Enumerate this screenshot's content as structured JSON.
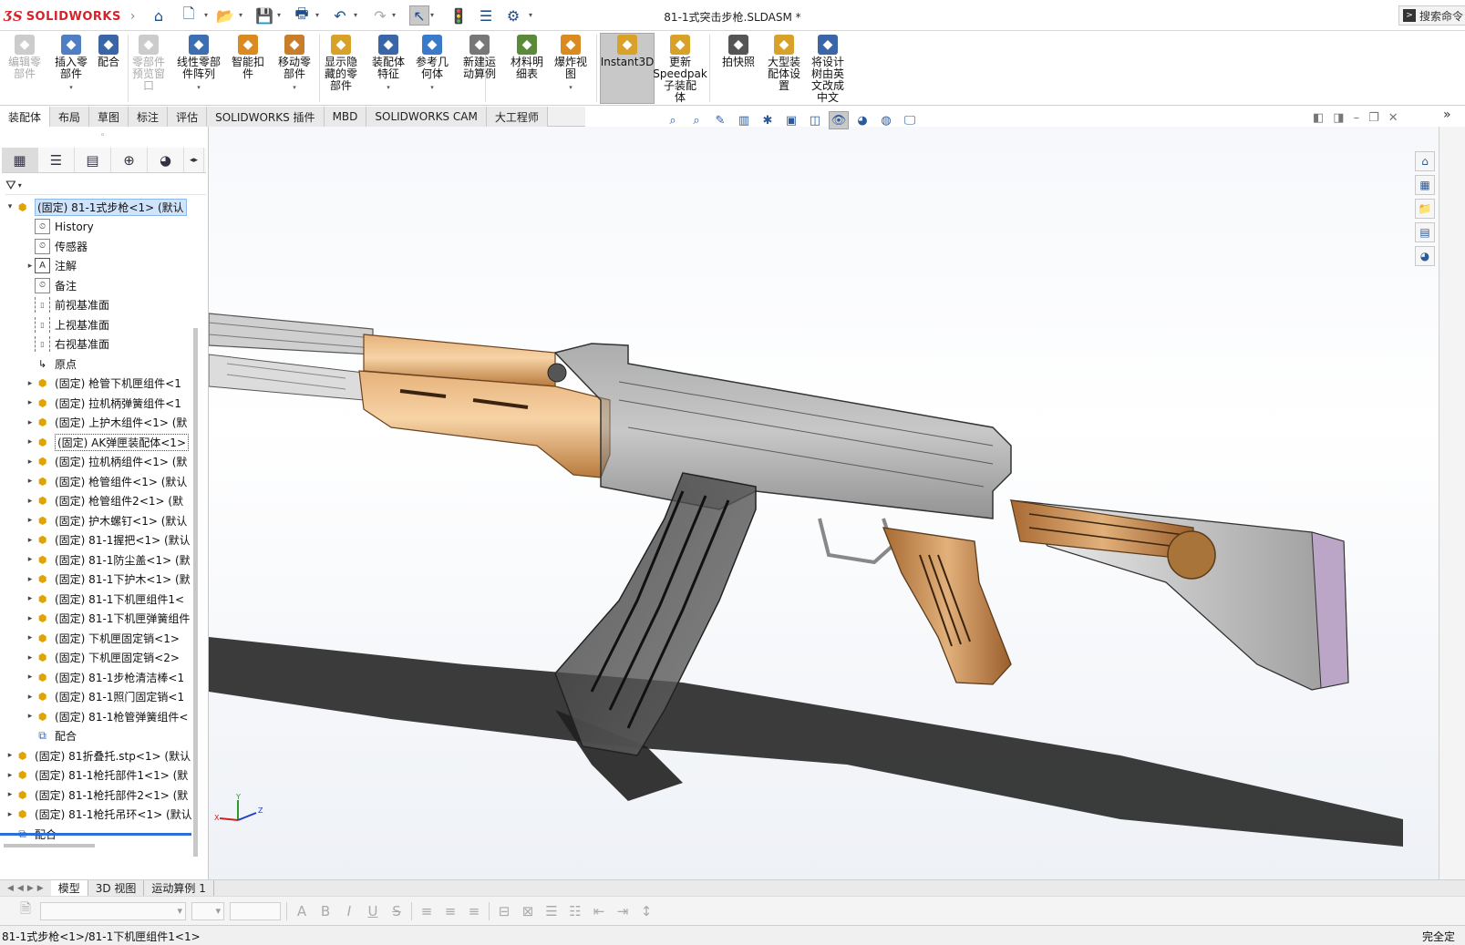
{
  "app": {
    "brand_ds": "ƷS",
    "brand_name": "SOLIDWORKS",
    "document_title": "81-1式突击步枪.SLDASM *",
    "search_placeholder": "搜索命令"
  },
  "quick_access": [
    {
      "name": "home-icon",
      "glyph": "⌂"
    },
    {
      "name": "new-document-icon",
      "glyph": "🗋"
    },
    {
      "name": "open-folder-icon",
      "glyph": "📂"
    },
    {
      "name": "save-icon",
      "glyph": "💾"
    },
    {
      "name": "print-icon",
      "glyph": "🖶"
    },
    {
      "name": "undo-icon",
      "glyph": "↶"
    },
    {
      "name": "redo-icon",
      "glyph": "↷"
    },
    {
      "name": "select-pointer-icon",
      "glyph": "↖"
    },
    {
      "name": "traffic-light-icon",
      "glyph": "🚦"
    },
    {
      "name": "file-properties-icon",
      "glyph": "☰"
    },
    {
      "name": "options-gear-icon",
      "glyph": "⚙"
    }
  ],
  "ribbon": {
    "buttons": [
      {
        "label": "编辑零\n部件",
        "disabled": true,
        "color": "#999"
      },
      {
        "label": "插入零\n部件",
        "disabled": false,
        "color": "#4f7fc2",
        "dropdown": true
      },
      {
        "label": "配合",
        "disabled": false,
        "color": "#3a66a8"
      },
      {
        "label": "零部件\n预览窗\n口",
        "disabled": true,
        "color": "#999"
      },
      {
        "label": "线性零部\n件阵列",
        "disabled": false,
        "color": "#3d6fb0",
        "dropdown": true
      },
      {
        "label": "智能扣\n件",
        "disabled": false,
        "color": "#d98b22"
      },
      {
        "label": "移动零\n部件",
        "disabled": false,
        "color": "#c87d2a",
        "dropdown": true
      },
      {
        "label": "显示隐\n藏的零\n部件",
        "disabled": false,
        "color": "#d8a22a"
      },
      {
        "label": "装配体\n特征",
        "disabled": false,
        "color": "#3a66a8",
        "dropdown": true
      },
      {
        "label": "参考几\n何体",
        "disabled": false,
        "color": "#3a7ac8",
        "dropdown": true
      },
      {
        "label": "新建运\n动算例",
        "disabled": false,
        "color": "#777"
      },
      {
        "label": "材料明\n细表",
        "disabled": false,
        "color": "#5a8a3a"
      },
      {
        "label": "爆炸视\n图",
        "disabled": false,
        "color": "#d98b22",
        "dropdown": true
      },
      {
        "label": "Instant3D",
        "disabled": false,
        "color": "#d8a22a",
        "active": true
      },
      {
        "label": "更新\nSpeedpak\n子装配\n体",
        "disabled": false,
        "color": "#d8a22a"
      },
      {
        "label": "拍快照",
        "disabled": false,
        "color": "#555"
      },
      {
        "label": "大型装\n配体设\n置",
        "disabled": false,
        "color": "#d8a22a"
      },
      {
        "label": "将设计\n树由英\n文改成\n中文",
        "disabled": false,
        "color": "#3a66a8"
      }
    ]
  },
  "tabs": [
    "装配体",
    "布局",
    "草图",
    "标注",
    "评估",
    "SOLIDWORKS 插件",
    "MBD",
    "SOLIDWORKS CAM",
    "大工程师"
  ],
  "left_toolbar": [
    "feature-manager-icon",
    "property-manager-icon",
    "configuration-manager-icon",
    "dimxpert-icon",
    "display-manager-icon"
  ],
  "tree": {
    "rows": [
      {
        "level": 0,
        "expand": "▾",
        "type": "asm",
        "label": "(固定) 81-1式步枪<1> (默认",
        "selected": true
      },
      {
        "level": 1,
        "expand": "",
        "type": "hist",
        "label": "History"
      },
      {
        "level": 1,
        "expand": "",
        "type": "hist",
        "label": "传感器"
      },
      {
        "level": 1,
        "expand": "▸",
        "type": "note",
        "label": "注解"
      },
      {
        "level": 1,
        "expand": "",
        "type": "hist",
        "label": "备注"
      },
      {
        "level": 1,
        "expand": "",
        "type": "plane",
        "label": "前视基准面"
      },
      {
        "level": 1,
        "expand": "",
        "type": "plane",
        "label": "上视基准面"
      },
      {
        "level": 1,
        "expand": "",
        "type": "plane",
        "label": "右视基准面"
      },
      {
        "level": 1,
        "expand": "",
        "type": "origin",
        "label": "原点"
      },
      {
        "level": 1,
        "expand": "▸",
        "type": "asm",
        "label": "(固定) 枪管下机匣组件<1"
      },
      {
        "level": 1,
        "expand": "▸",
        "type": "asm",
        "label": "(固定) 拉机柄弹簧组件<1"
      },
      {
        "level": 1,
        "expand": "▸",
        "type": "asm",
        "label": "(固定) 上护木组件<1> (默"
      },
      {
        "level": 1,
        "expand": "▸",
        "type": "asm",
        "label": "(固定) AK弹匣装配体<1>",
        "boxed": true
      },
      {
        "level": 1,
        "expand": "▸",
        "type": "asm",
        "label": "(固定) 拉机柄组件<1> (默"
      },
      {
        "level": 1,
        "expand": "▸",
        "type": "asm",
        "label": "(固定) 枪管组件<1> (默认"
      },
      {
        "level": 1,
        "expand": "▸",
        "type": "asm",
        "label": "(固定) 枪管组件2<1> (默"
      },
      {
        "level": 1,
        "expand": "▸",
        "type": "part",
        "label": "(固定) 护木螺钉<1> (默认"
      },
      {
        "level": 1,
        "expand": "▸",
        "type": "part",
        "label": "(固定) 81-1握把<1> (默认"
      },
      {
        "level": 1,
        "expand": "▸",
        "type": "part",
        "label": "(固定) 81-1防尘盖<1> (默"
      },
      {
        "level": 1,
        "expand": "▸",
        "type": "part",
        "label": "(固定) 81-1下护木<1> (默"
      },
      {
        "level": 1,
        "expand": "▸",
        "type": "part",
        "label": "(固定) 81-1下机匣组件1<"
      },
      {
        "level": 1,
        "expand": "▸",
        "type": "part",
        "label": "(固定) 81-1下机匣弹簧组件"
      },
      {
        "level": 1,
        "expand": "▸",
        "type": "part",
        "label": "(固定) 下机匣固定销<1>"
      },
      {
        "level": 1,
        "expand": "▸",
        "type": "part",
        "label": "(固定) 下机匣固定销<2>"
      },
      {
        "level": 1,
        "expand": "▸",
        "type": "part",
        "label": "(固定) 81-1步枪清洁棒<1"
      },
      {
        "level": 1,
        "expand": "▸",
        "type": "part",
        "label": "(固定) 81-1照门固定销<1"
      },
      {
        "level": 1,
        "expand": "▸",
        "type": "part",
        "label": "(固定) 81-1枪管弹簧组件<"
      },
      {
        "level": 1,
        "expand": "",
        "type": "mate",
        "label": "配合"
      },
      {
        "level": 0,
        "expand": "▸",
        "type": "asm",
        "label": "(固定) 81折叠托.stp<1> (默认"
      },
      {
        "level": 0,
        "expand": "▸",
        "type": "part",
        "label": "(固定) 81-1枪托部件1<1> (默"
      },
      {
        "level": 0,
        "expand": "▸",
        "type": "part",
        "label": "(固定) 81-1枪托部件2<1> (默"
      },
      {
        "level": 0,
        "expand": "▸",
        "type": "part",
        "label": "(固定) 81-1枪托吊环<1> (默认"
      },
      {
        "level": 0,
        "expand": "",
        "type": "mate",
        "label": "配合"
      }
    ]
  },
  "bottom_tabs": [
    "模型",
    "3D 视图",
    "运动算例 1"
  ],
  "status": {
    "path": "81-1式步枪<1>/81-1下机匣组件1<1>",
    "right": "完全定义"
  },
  "triad": {
    "x": "X",
    "y": "Y",
    "z": "Z"
  },
  "colors": {
    "wood": "#c98f52",
    "wood_light": "#f0c48e",
    "steel": "#4a4a4a",
    "accent": "#d6232b"
  }
}
